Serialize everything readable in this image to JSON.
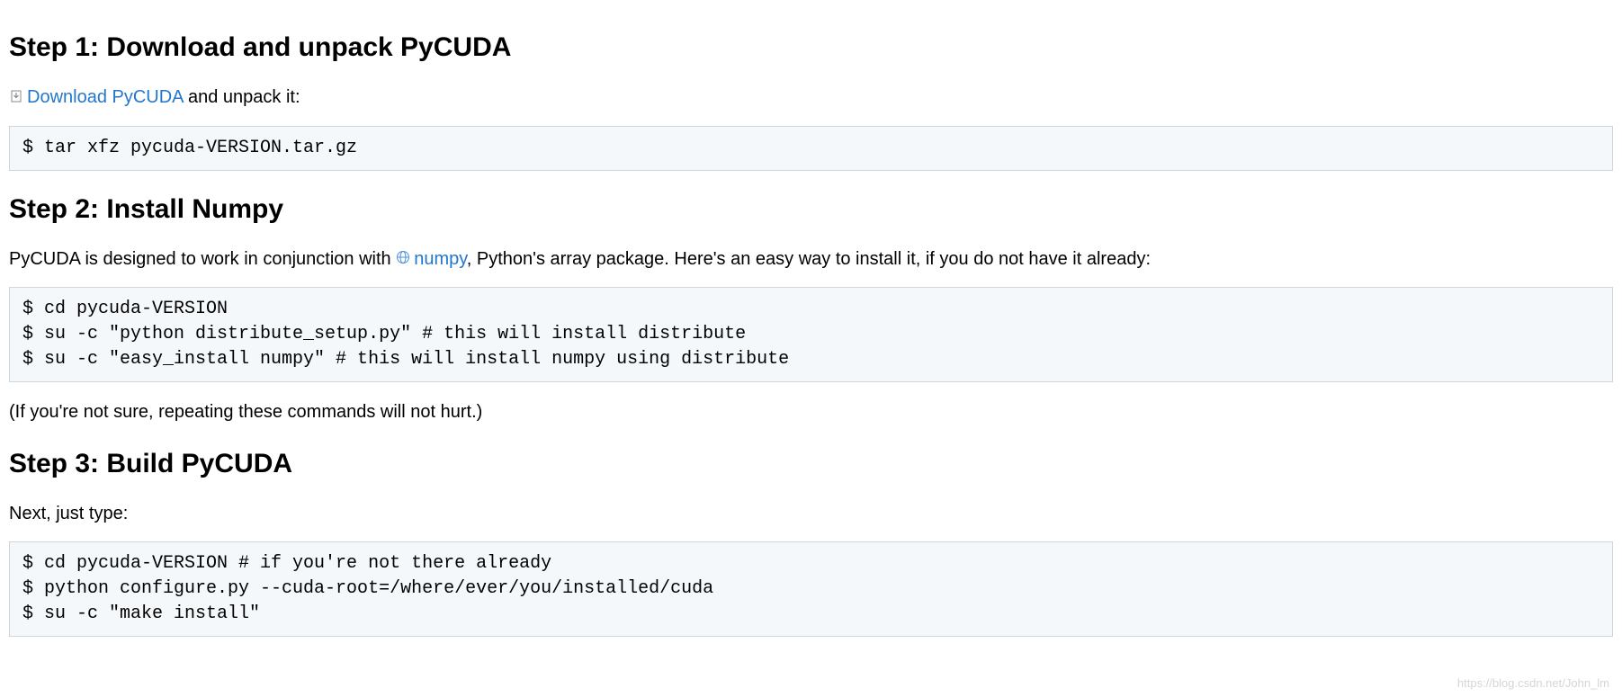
{
  "steps": [
    {
      "heading": "Step 1: Download and unpack PyCUDA",
      "intro_prefix": "",
      "link_text": "Download PyCUDA",
      "intro_suffix": " and unpack it:",
      "code": "$ tar xfz pycuda-VERSION.tar.gz"
    },
    {
      "heading": "Step 2: Install Numpy",
      "intro_prefix": "PyCUDA is designed to work in conjunction with ",
      "link_text": "numpy",
      "intro_suffix": ", Python's array package. Here's an easy way to install it, if you do not have it already:",
      "code": "$ cd pycuda-VERSION\n$ su -c \"python distribute_setup.py\" # this will install distribute\n$ su -c \"easy_install numpy\" # this will install numpy using distribute",
      "note": "(If you're not sure, repeating these commands will not hurt.)"
    },
    {
      "heading": "Step 3: Build PyCUDA",
      "intro_text": "Next, just type:",
      "code": "$ cd pycuda-VERSION # if you're not there already\n$ python configure.py --cuda-root=/where/ever/you/installed/cuda\n$ su -c \"make install\""
    }
  ],
  "watermark": "https://blog.csdn.net/John_lm"
}
